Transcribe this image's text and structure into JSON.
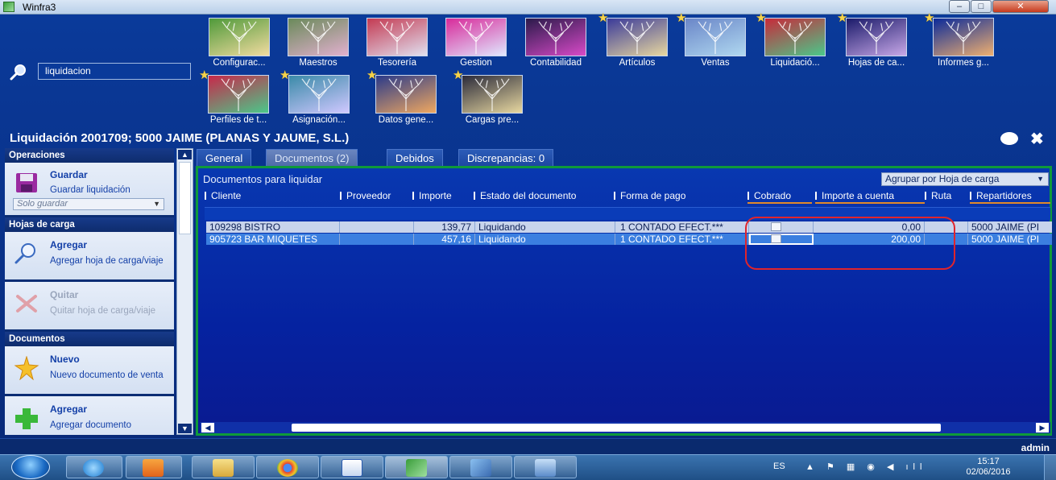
{
  "window": {
    "title": "Winfra3",
    "minimize": "–",
    "maximize": "□",
    "close": "✕"
  },
  "search": {
    "value": "liquidacion"
  },
  "modules": [
    {
      "label": "Configurac...",
      "starred": false,
      "colors": [
        "#4f9a3a",
        "#f2dba0"
      ]
    },
    {
      "label": "Maestros",
      "starred": false,
      "colors": [
        "#6a8a5a",
        "#e2b0cf"
      ]
    },
    {
      "label": "Tesorería",
      "starred": false,
      "colors": [
        "#c43a52",
        "#e0e0f0"
      ]
    },
    {
      "label": "Gestion",
      "starred": false,
      "colors": [
        "#d82a9a",
        "#e0e8ff"
      ]
    },
    {
      "label": "Contabilidad",
      "starred": false,
      "colors": [
        "#2a1a4a",
        "#d84ac8"
      ]
    },
    {
      "label": "Artículos",
      "starred": true,
      "colors": [
        "#3a3a9a",
        "#e8d8a0"
      ]
    },
    {
      "label": "Ventas",
      "starred": true,
      "colors": [
        "#6a86c8",
        "#b0d8f0"
      ]
    },
    {
      "label": "Liquidació...",
      "starred": true,
      "colors": [
        "#c82a3a",
        "#4ac88a"
      ]
    },
    {
      "label": "Hojas de ca...",
      "starred": true,
      "colors": [
        "#1a1a6a",
        "#c8a8e8"
      ]
    },
    {
      "label": "Informes g...",
      "starred": true,
      "colors": [
        "#0a2a9a",
        "#f0b070"
      ]
    },
    {
      "label": "Perfiles de t...",
      "starred": true,
      "colors": [
        "#c8284a",
        "#4ac88a"
      ]
    },
    {
      "label": "Asignación...",
      "starred": true,
      "colors": [
        "#3a8aa8",
        "#d0c8ff"
      ]
    },
    {
      "label": "Datos gene...",
      "starred": true,
      "colors": [
        "#2a3a8a",
        "#f0a860"
      ]
    },
    {
      "label": "Cargas pre...",
      "starred": true,
      "colors": [
        "#2a2a3a",
        "#e8d8a0"
      ]
    }
  ],
  "page": {
    "title": "Liquidación 2001709; 5000 JAIME (PLANAS Y JAUME, S.L.)"
  },
  "sidebar": {
    "operaciones": {
      "header": "Operaciones",
      "save_title": "Guardar",
      "save_desc": "Guardar liquidación",
      "save_mode": "Solo guardar"
    },
    "hojas": {
      "header": "Hojas de carga",
      "add_title": "Agregar",
      "add_desc": "Agregar hoja de carga/viaje",
      "remove_title": "Quitar",
      "remove_desc": "Quitar hoja de carga/viaje"
    },
    "documentos": {
      "header": "Documentos",
      "new_title": "Nuevo",
      "new_desc": "Nuevo documento de venta",
      "add_title": "Agregar",
      "add_desc": "Agregar documento"
    }
  },
  "tabs": [
    {
      "label": "General",
      "active": false
    },
    {
      "label": "Documentos (2)",
      "active": true
    },
    {
      "label": "Debidos",
      "active": false
    },
    {
      "label": "Discrepancias: 0",
      "active": false
    }
  ],
  "panel": {
    "title": "Documentos para liquidar",
    "group_by": "Agrupar por Hoja de carga",
    "columns": [
      "Cliente",
      "Proveedor",
      "Importe",
      "Estado del documento",
      "Forma de pago",
      "Cobrado",
      "Importe a cuenta",
      "Ruta",
      "Repartidores"
    ],
    "rows": [
      {
        "cliente": "109298 BISTRO",
        "proveedor": "",
        "importe": "139,77",
        "estado": "Liquidando",
        "forma_pago": "1 CONTADO EFECT.***",
        "cobrado": false,
        "importe_cuenta": "0,00",
        "ruta": "",
        "repartidores": "5000 JAIME (PI",
        "selected": false
      },
      {
        "cliente": "905723 BAR MIQUETES",
        "proveedor": "",
        "importe": "457,16",
        "estado": "Liquidando",
        "forma_pago": "1 CONTADO EFECT.***",
        "cobrado": false,
        "importe_cuenta": "200,00",
        "ruta": "",
        "repartidores": "5000 JAIME (PI",
        "selected": true
      }
    ]
  },
  "status": {
    "user": "admin"
  },
  "taskbar": {
    "lang": "ES",
    "tray_icons": "▲ ⚑ ▦ ◉ ◀ ıll",
    "time": "15:17",
    "date": "02/06/2016"
  }
}
